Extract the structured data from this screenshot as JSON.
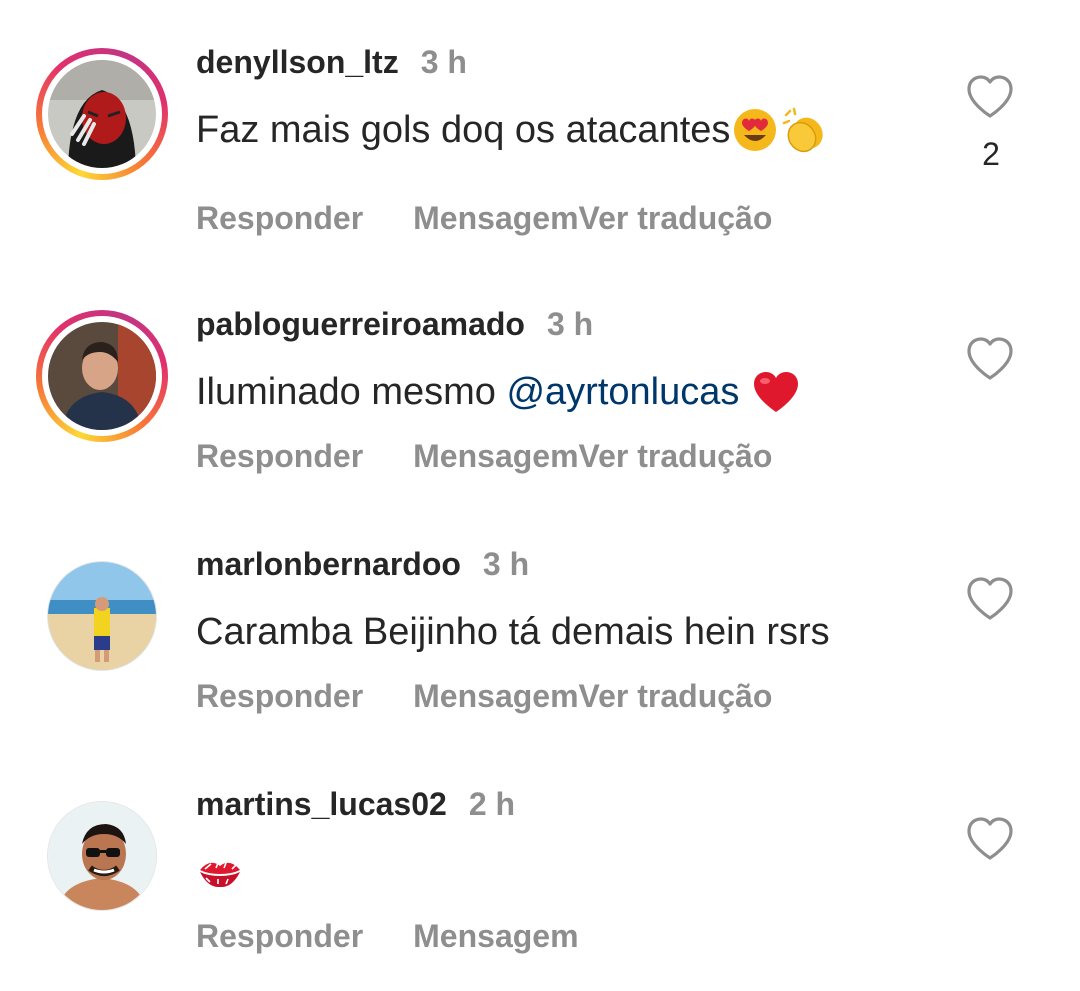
{
  "comments": [
    {
      "username": "denyllson_ltz",
      "time": "3 h",
      "text": "Faz mais gols doq os atacantes",
      "emojis": [
        "heart-eyes-emoji",
        "clapping-hands-emoji"
      ],
      "likes": "2",
      "reply_label": "Responder",
      "message_label": "Mensagem",
      "translate_label": "Ver tradução",
      "story_ring": true
    },
    {
      "username": "pabloguerreiroamado",
      "time": "3 h",
      "text": "Iluminado mesmo",
      "mention": "@ayrtonlucas",
      "emojis": [
        "red-heart-emoji"
      ],
      "reply_label": "Responder",
      "message_label": "Mensagem",
      "translate_label": "Ver tradução",
      "story_ring": true
    },
    {
      "username": "marlonbernardoo",
      "time": "3 h",
      "text": "Caramba Beijinho tá demais hein rsrs",
      "reply_label": "Responder",
      "message_label": "Mensagem",
      "translate_label": "Ver tradução",
      "story_ring": false
    },
    {
      "username": "martins_lucas02",
      "time": "2 h",
      "text": "",
      "emojis": [
        "kiss-mark-emoji"
      ],
      "reply_label": "Responder",
      "message_label": "Mensagem",
      "story_ring": false
    }
  ],
  "colors": {
    "text": "#262626",
    "muted": "#8e8e8e",
    "mention": "#00376b",
    "heart_outline": "#8e8e8e"
  }
}
